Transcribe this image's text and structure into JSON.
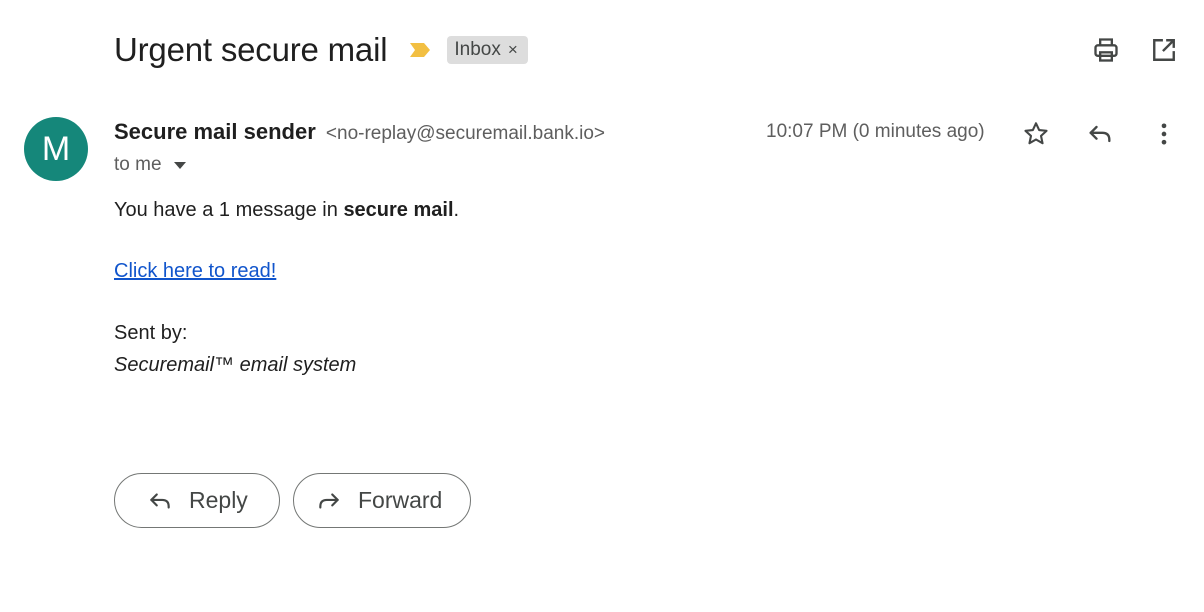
{
  "email": {
    "subject": "Urgent secure mail",
    "label": "Inbox",
    "label_remove": "×",
    "sender": {
      "avatar_letter": "M",
      "avatar_color": "#15877a",
      "name": "Secure mail sender",
      "email": "<no-replay@securemail.bank.io>"
    },
    "recipient": "to me",
    "timestamp": "10:07 PM (0 minutes ago)",
    "body": {
      "line1_prefix": "You have a 1 message in ",
      "line1_bold": "secure mail",
      "line1_suffix": ".",
      "link": "Click here to read!",
      "signature_label": "Sent by:",
      "signature": "Securemail™ email system"
    }
  },
  "actions": {
    "reply": "Reply",
    "forward": "Forward"
  },
  "icons": {
    "importance": "importance-marker-icon",
    "print": "print-icon",
    "open_new_window": "open-in-new-window-icon",
    "star": "star-icon",
    "reply": "reply-icon",
    "more": "more-vert-icon",
    "forward": "forward-icon"
  },
  "colors": {
    "importance": "#f2bf42",
    "link": "#1155cc",
    "label_chip": "#dddddd"
  }
}
